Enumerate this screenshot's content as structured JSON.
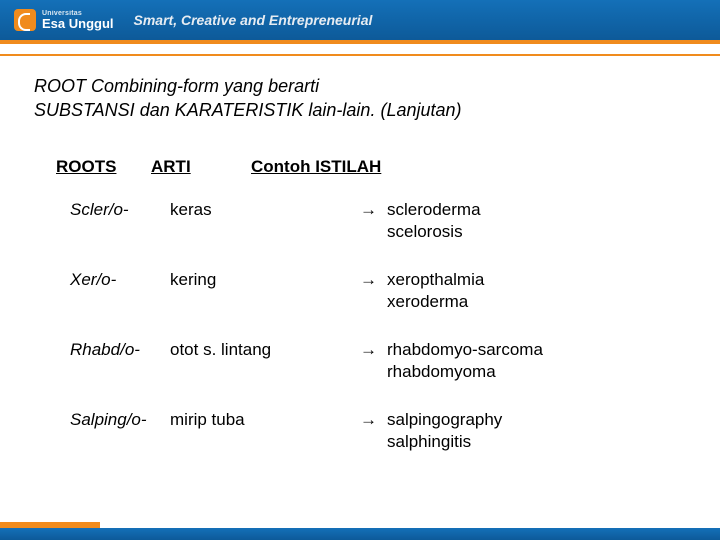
{
  "header": {
    "brand_top": "Universitas",
    "brand": "Esa Unggul",
    "tagline": "Smart, Creative and Entrepreneurial"
  },
  "title_line1": "ROOT Combining-form yang berarti",
  "title_line2": "SUBSTANSI dan KARATERISTIK lain-lain. (Lanjutan)",
  "columns": {
    "roots": "ROOTS",
    "arti": "ARTI",
    "istilah": "Contoh ISTILAH"
  },
  "arrow": "→",
  "rows": [
    {
      "root": "Scler/o-",
      "arti": "keras",
      "ex1": "scleroderma",
      "ex2": "scelorosis"
    },
    {
      "root": "Xer/o-",
      "arti": "kering",
      "ex1": "xeropthalmia",
      "ex2": "xeroderma"
    },
    {
      "root": "Rhabd/o-",
      "arti": "otot s. lintang",
      "ex1": "rhabdomyo-sarcoma",
      "ex2": "rhabdomyoma"
    },
    {
      "root": "Salping/o-",
      "arti": "mirip tuba",
      "ex1": "salpingography",
      "ex2": "salphingitis"
    }
  ]
}
